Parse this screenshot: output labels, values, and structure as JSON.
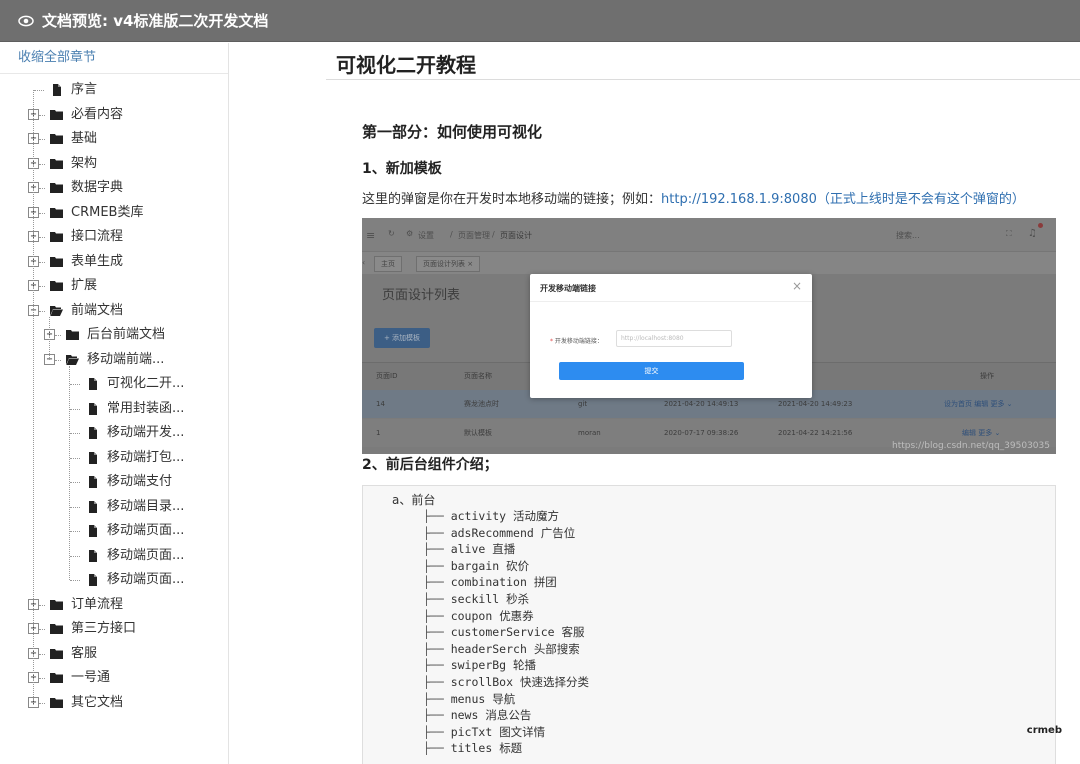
{
  "window": {
    "title": "文档预览: v4标准版二次开发文档"
  },
  "sidebar": {
    "collapse_all": "收缩全部章节",
    "items": [
      {
        "label": "序言",
        "level": 0,
        "type": "file",
        "toggle": "none"
      },
      {
        "label": "必看内容",
        "level": 0,
        "type": "folder",
        "toggle": "plus"
      },
      {
        "label": "基础",
        "level": 0,
        "type": "folder",
        "toggle": "plus"
      },
      {
        "label": "架构",
        "level": 0,
        "type": "folder",
        "toggle": "plus"
      },
      {
        "label": "数据字典",
        "level": 0,
        "type": "folder",
        "toggle": "plus"
      },
      {
        "label": "CRMEB类库",
        "level": 0,
        "type": "folder",
        "toggle": "plus"
      },
      {
        "label": "接口流程",
        "level": 0,
        "type": "folder",
        "toggle": "plus"
      },
      {
        "label": "表单生成",
        "level": 0,
        "type": "folder",
        "toggle": "plus"
      },
      {
        "label": "扩展",
        "level": 0,
        "type": "folder",
        "toggle": "plus"
      },
      {
        "label": "前端文档",
        "level": 0,
        "type": "folder-open",
        "toggle": "minus"
      },
      {
        "label": "后台前端文档",
        "level": 1,
        "type": "folder",
        "toggle": "plus"
      },
      {
        "label": "移动端前端...",
        "level": 1,
        "type": "folder-open",
        "toggle": "minus"
      },
      {
        "label": "可视化二开...",
        "level": 2,
        "type": "file",
        "toggle": "none"
      },
      {
        "label": "常用封装函...",
        "level": 2,
        "type": "file",
        "toggle": "none"
      },
      {
        "label": "移动端开发...",
        "level": 2,
        "type": "file",
        "toggle": "none"
      },
      {
        "label": "移动端打包...",
        "level": 2,
        "type": "file",
        "toggle": "none"
      },
      {
        "label": "移动端支付",
        "level": 2,
        "type": "file",
        "toggle": "none"
      },
      {
        "label": "移动端目录...",
        "level": 2,
        "type": "file",
        "toggle": "none"
      },
      {
        "label": "移动端页面...",
        "level": 2,
        "type": "file",
        "toggle": "none"
      },
      {
        "label": "移动端页面...",
        "level": 2,
        "type": "file",
        "toggle": "none"
      },
      {
        "label": "移动端页面...",
        "level": 2,
        "type": "file",
        "toggle": "none"
      },
      {
        "label": "订单流程",
        "level": 0,
        "type": "folder",
        "toggle": "plus"
      },
      {
        "label": "第三方接口",
        "level": 0,
        "type": "folder",
        "toggle": "plus"
      },
      {
        "label": "客服",
        "level": 0,
        "type": "folder",
        "toggle": "plus"
      },
      {
        "label": "一号通",
        "level": 0,
        "type": "folder",
        "toggle": "plus"
      },
      {
        "label": "其它文档",
        "level": 0,
        "type": "folder",
        "toggle": "plus"
      }
    ]
  },
  "doc": {
    "title": "可视化二开教程",
    "section1": "第一部分：如何使用可视化",
    "step1": "1、新加模板",
    "para_text": "这里的弹窗是你在开发时本地移动端的链接；例如：",
    "para_link": "http://192.168.1.9:8080（正式上线时是不会有这个弹窗的）",
    "step2": "2、前后台组件介绍；",
    "code_head": "a、前台",
    "code_lines": [
      {
        "name": "activity",
        "desc": "活动魔方"
      },
      {
        "name": "adsRecommend",
        "desc": "广告位"
      },
      {
        "name": "alive",
        "desc": "直播"
      },
      {
        "name": "bargain",
        "desc": "砍价"
      },
      {
        "name": "combination",
        "desc": "拼团"
      },
      {
        "name": "seckill",
        "desc": "秒杀"
      },
      {
        "name": "coupon",
        "desc": "优惠券"
      },
      {
        "name": "customerService",
        "desc": "客服"
      },
      {
        "name": "headerSerch",
        "desc": "头部搜索"
      },
      {
        "name": "swiperBg",
        "desc": "轮播"
      },
      {
        "name": "scrollBox",
        "desc": "快速选择分类"
      },
      {
        "name": "menus",
        "desc": "导航"
      },
      {
        "name": "news",
        "desc": "消息公告"
      },
      {
        "name": "picTxt",
        "desc": "图文详情"
      },
      {
        "name": "titles",
        "desc": "标题"
      }
    ]
  },
  "embedded_screenshot": {
    "breadcrumb": [
      "设置",
      "页面管理",
      "页面设计"
    ],
    "search_placeholder": "搜索...",
    "tabs": [
      "主页",
      "页面设计列表"
    ],
    "list_title": "页面设计列表",
    "add_button": "+ 添加模板",
    "columns": [
      "页面ID",
      "页面名称",
      "",
      "",
      "",
      "操作"
    ],
    "rows": [
      {
        "id": "14",
        "name": "赛龙池点时",
        "author": "git",
        "created": "2021-04-20 14:49:13",
        "updated": "2021-04-20 14:49:23",
        "actions": "设为首页  编辑  更多 ⌄"
      },
      {
        "id": "1",
        "name": "默认模板",
        "author": "moran",
        "created": "2020-07-17 09:38:26",
        "updated": "2021-04-22 14:21:56",
        "actions": "编辑  更多 ⌄"
      }
    ],
    "dialog": {
      "title": "开发移动端链接",
      "field_label": "开发移动端链接：",
      "field_placeholder": "http://localhost:8080",
      "submit": "提交"
    },
    "watermark": "https://blog.csdn.net/qq_39503035"
  },
  "logo": "crmeb"
}
